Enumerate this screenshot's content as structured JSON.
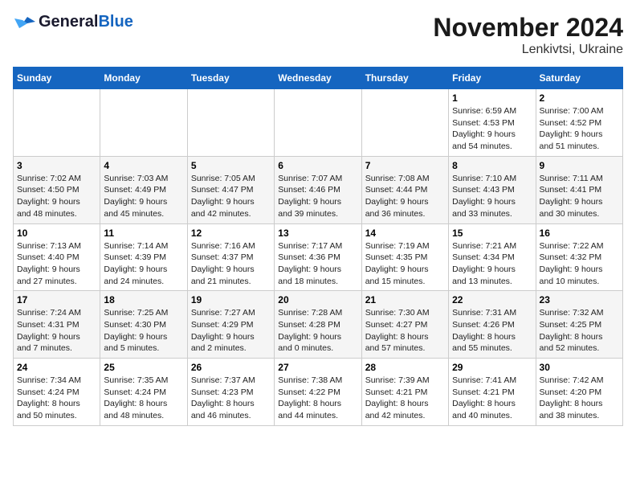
{
  "header": {
    "logo_general": "General",
    "logo_blue": "Blue",
    "title": "November 2024",
    "subtitle": "Lenkivtsi, Ukraine"
  },
  "weekdays": [
    "Sunday",
    "Monday",
    "Tuesday",
    "Wednesday",
    "Thursday",
    "Friday",
    "Saturday"
  ],
  "weeks": [
    [
      {
        "day": "",
        "info": ""
      },
      {
        "day": "",
        "info": ""
      },
      {
        "day": "",
        "info": ""
      },
      {
        "day": "",
        "info": ""
      },
      {
        "day": "",
        "info": ""
      },
      {
        "day": "1",
        "info": "Sunrise: 6:59 AM\nSunset: 4:53 PM\nDaylight: 9 hours\nand 54 minutes."
      },
      {
        "day": "2",
        "info": "Sunrise: 7:00 AM\nSunset: 4:52 PM\nDaylight: 9 hours\nand 51 minutes."
      }
    ],
    [
      {
        "day": "3",
        "info": "Sunrise: 7:02 AM\nSunset: 4:50 PM\nDaylight: 9 hours\nand 48 minutes."
      },
      {
        "day": "4",
        "info": "Sunrise: 7:03 AM\nSunset: 4:49 PM\nDaylight: 9 hours\nand 45 minutes."
      },
      {
        "day": "5",
        "info": "Sunrise: 7:05 AM\nSunset: 4:47 PM\nDaylight: 9 hours\nand 42 minutes."
      },
      {
        "day": "6",
        "info": "Sunrise: 7:07 AM\nSunset: 4:46 PM\nDaylight: 9 hours\nand 39 minutes."
      },
      {
        "day": "7",
        "info": "Sunrise: 7:08 AM\nSunset: 4:44 PM\nDaylight: 9 hours\nand 36 minutes."
      },
      {
        "day": "8",
        "info": "Sunrise: 7:10 AM\nSunset: 4:43 PM\nDaylight: 9 hours\nand 33 minutes."
      },
      {
        "day": "9",
        "info": "Sunrise: 7:11 AM\nSunset: 4:41 PM\nDaylight: 9 hours\nand 30 minutes."
      }
    ],
    [
      {
        "day": "10",
        "info": "Sunrise: 7:13 AM\nSunset: 4:40 PM\nDaylight: 9 hours\nand 27 minutes."
      },
      {
        "day": "11",
        "info": "Sunrise: 7:14 AM\nSunset: 4:39 PM\nDaylight: 9 hours\nand 24 minutes."
      },
      {
        "day": "12",
        "info": "Sunrise: 7:16 AM\nSunset: 4:37 PM\nDaylight: 9 hours\nand 21 minutes."
      },
      {
        "day": "13",
        "info": "Sunrise: 7:17 AM\nSunset: 4:36 PM\nDaylight: 9 hours\nand 18 minutes."
      },
      {
        "day": "14",
        "info": "Sunrise: 7:19 AM\nSunset: 4:35 PM\nDaylight: 9 hours\nand 15 minutes."
      },
      {
        "day": "15",
        "info": "Sunrise: 7:21 AM\nSunset: 4:34 PM\nDaylight: 9 hours\nand 13 minutes."
      },
      {
        "day": "16",
        "info": "Sunrise: 7:22 AM\nSunset: 4:32 PM\nDaylight: 9 hours\nand 10 minutes."
      }
    ],
    [
      {
        "day": "17",
        "info": "Sunrise: 7:24 AM\nSunset: 4:31 PM\nDaylight: 9 hours\nand 7 minutes."
      },
      {
        "day": "18",
        "info": "Sunrise: 7:25 AM\nSunset: 4:30 PM\nDaylight: 9 hours\nand 5 minutes."
      },
      {
        "day": "19",
        "info": "Sunrise: 7:27 AM\nSunset: 4:29 PM\nDaylight: 9 hours\nand 2 minutes."
      },
      {
        "day": "20",
        "info": "Sunrise: 7:28 AM\nSunset: 4:28 PM\nDaylight: 9 hours\nand 0 minutes."
      },
      {
        "day": "21",
        "info": "Sunrise: 7:30 AM\nSunset: 4:27 PM\nDaylight: 8 hours\nand 57 minutes."
      },
      {
        "day": "22",
        "info": "Sunrise: 7:31 AM\nSunset: 4:26 PM\nDaylight: 8 hours\nand 55 minutes."
      },
      {
        "day": "23",
        "info": "Sunrise: 7:32 AM\nSunset: 4:25 PM\nDaylight: 8 hours\nand 52 minutes."
      }
    ],
    [
      {
        "day": "24",
        "info": "Sunrise: 7:34 AM\nSunset: 4:24 PM\nDaylight: 8 hours\nand 50 minutes."
      },
      {
        "day": "25",
        "info": "Sunrise: 7:35 AM\nSunset: 4:24 PM\nDaylight: 8 hours\nand 48 minutes."
      },
      {
        "day": "26",
        "info": "Sunrise: 7:37 AM\nSunset: 4:23 PM\nDaylight: 8 hours\nand 46 minutes."
      },
      {
        "day": "27",
        "info": "Sunrise: 7:38 AM\nSunset: 4:22 PM\nDaylight: 8 hours\nand 44 minutes."
      },
      {
        "day": "28",
        "info": "Sunrise: 7:39 AM\nSunset: 4:21 PM\nDaylight: 8 hours\nand 42 minutes."
      },
      {
        "day": "29",
        "info": "Sunrise: 7:41 AM\nSunset: 4:21 PM\nDaylight: 8 hours\nand 40 minutes."
      },
      {
        "day": "30",
        "info": "Sunrise: 7:42 AM\nSunset: 4:20 PM\nDaylight: 8 hours\nand 38 minutes."
      }
    ]
  ]
}
